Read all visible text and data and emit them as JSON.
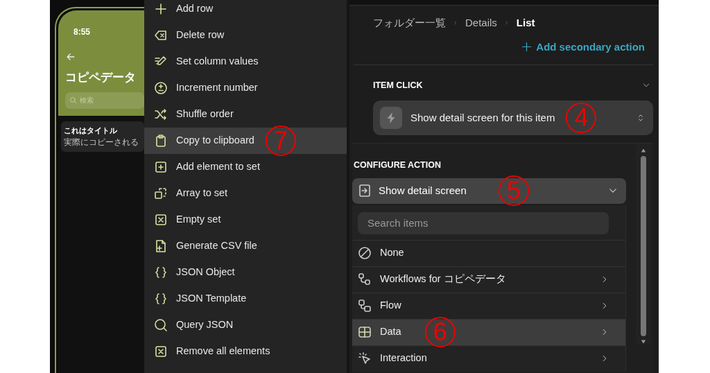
{
  "phone": {
    "time": "8:55",
    "title": "コピペデータ",
    "search_placeholder": "検索",
    "card": {
      "title": "これはタイトル",
      "subtitle": "実際にコピーされる"
    }
  },
  "action_menu": {
    "annotation": "7",
    "items": [
      {
        "label": "Add row",
        "selected": false
      },
      {
        "label": "Delete row",
        "selected": false
      },
      {
        "label": "Set column values",
        "selected": false
      },
      {
        "label": "Increment number",
        "selected": false
      },
      {
        "label": "Shuffle order",
        "selected": false
      },
      {
        "label": "Copy to clipboard",
        "selected": true
      },
      {
        "label": "Add element to set",
        "selected": false
      },
      {
        "label": "Array to set",
        "selected": false
      },
      {
        "label": "Empty set",
        "selected": false
      },
      {
        "label": "Generate CSV file",
        "selected": false
      },
      {
        "label": "JSON Object",
        "selected": false
      },
      {
        "label": "JSON Template",
        "selected": false
      },
      {
        "label": "Query JSON",
        "selected": false
      },
      {
        "label": "Remove all elements",
        "selected": false
      }
    ]
  },
  "breadcrumb": [
    {
      "label": "フォルダー一覧",
      "current": false
    },
    {
      "label": "Details",
      "current": false
    },
    {
      "label": "List",
      "current": true
    }
  ],
  "secondary_action": "Add secondary action",
  "item_click": {
    "heading": "ITEM CLICK",
    "value": "Show detail screen for this item",
    "annotation": "4"
  },
  "configure_action": {
    "heading": "CONFIGURE ACTION",
    "value": "Show detail screen",
    "annotation": "5",
    "search_placeholder": "Search items",
    "options": [
      {
        "label": "None",
        "selected": false,
        "has_submenu": false
      },
      {
        "label": "Workflows for コピペデータ",
        "selected": false,
        "has_submenu": true
      },
      {
        "label": "Flow",
        "selected": false,
        "has_submenu": true
      },
      {
        "label": "Data",
        "selected": true,
        "has_submenu": true,
        "annotation": "6"
      },
      {
        "label": "Interaction",
        "selected": false,
        "has_submenu": true
      }
    ]
  }
}
